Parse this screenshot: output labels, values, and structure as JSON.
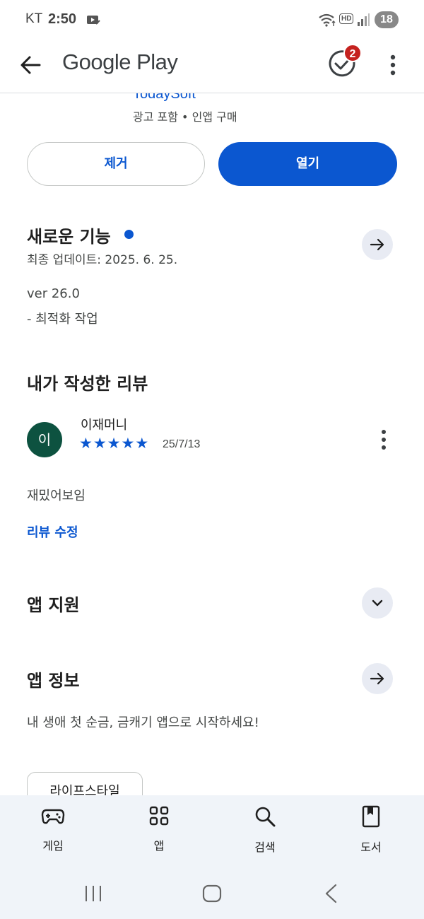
{
  "status_bar": {
    "carrier": "KT",
    "time": "2:50",
    "hd": "HD",
    "battery": "18"
  },
  "app_bar": {
    "title": "Google Play",
    "update_badge_count": "2"
  },
  "app": {
    "developer": "TodaySoft",
    "meta": "광고 포함 • 인앱 구매",
    "uninstall_label": "제거",
    "open_label": "열기"
  },
  "whats_new": {
    "title": "새로운 기능",
    "last_updated": "최종 업데이트: 2025. 6. 25.",
    "version": "ver 26.0",
    "notes": "- 최적화 작업"
  },
  "my_review": {
    "title": "내가 작성한 리뷰",
    "avatar_initial": "이",
    "reviewer_name": "이재머니",
    "rating": 5,
    "stars": [
      "★",
      "★",
      "★",
      "★",
      "★"
    ],
    "date": "25/7/13",
    "text": "재밌어보임",
    "edit_label": "리뷰 수정"
  },
  "app_support": {
    "title": "앱 지원"
  },
  "app_info": {
    "title": "앱 정보",
    "description": "내 생애 첫 순금, 금캐기 앱으로 시작하세요!",
    "category_chip": "라이프스타일"
  },
  "bottom_nav": {
    "items": [
      {
        "label": "게임",
        "icon": "gamepad-icon"
      },
      {
        "label": "앱",
        "icon": "apps-grid-icon"
      },
      {
        "label": "검색",
        "icon": "search-icon"
      },
      {
        "label": "도서",
        "icon": "book-icon"
      }
    ]
  },
  "colors": {
    "accent": "#0b57d0",
    "avatar_bg": "#0d5240",
    "badge": "#c5221f",
    "round_button_bg": "#e8ebf3",
    "nav_bg": "#f0f4f9"
  }
}
